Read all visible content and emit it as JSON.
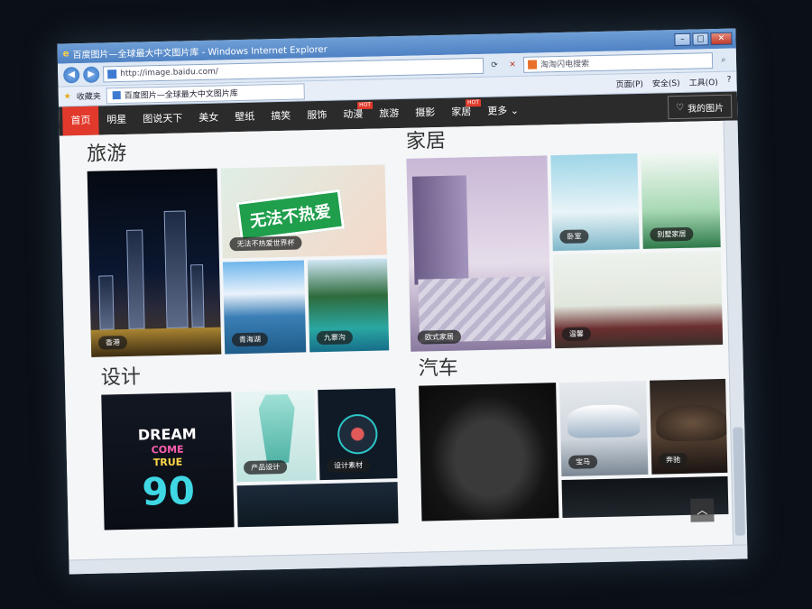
{
  "browser": {
    "title": "百度图片—全球最大中文图片库 - Windows Internet Explorer",
    "url": "http://image.baidu.com/",
    "search_placeholder": "淘淘闪电搜索",
    "favorites_label": "收藏夹",
    "tab_title": "百度图片—全球最大中文图片库",
    "tools": [
      "页面(P)",
      "安全(S)",
      "工具(O)"
    ]
  },
  "nav": {
    "items": [
      {
        "label": "首页",
        "active": true
      },
      {
        "label": "明星"
      },
      {
        "label": "图说天下"
      },
      {
        "label": "美女"
      },
      {
        "label": "壁纸"
      },
      {
        "label": "搞笑"
      },
      {
        "label": "服饰"
      },
      {
        "label": "动漫",
        "badge": "HOT"
      },
      {
        "label": "旅游"
      },
      {
        "label": "摄影"
      },
      {
        "label": "家居",
        "badge": "HOT"
      },
      {
        "label": "更多"
      }
    ],
    "my_images": "我的图片"
  },
  "sections": {
    "travel": {
      "title": "旅游",
      "captions": [
        "香港",
        "无法不热爱世界杯",
        "青海湖",
        "九寨沟"
      ],
      "ad_text": "无法不热爱"
    },
    "home": {
      "title": "家居",
      "captions": [
        "欧式家居",
        "卧室",
        "别墅家居",
        "温馨"
      ]
    },
    "design": {
      "title": "设计",
      "captions": [
        "产品设计",
        "设计素材"
      ],
      "art": {
        "line1": "DREAM",
        "line2": "COME",
        "line3": "TRUE",
        "num": "90"
      }
    },
    "car": {
      "title": "汽车",
      "captions": [
        "宝马",
        "奔驰"
      ]
    }
  }
}
